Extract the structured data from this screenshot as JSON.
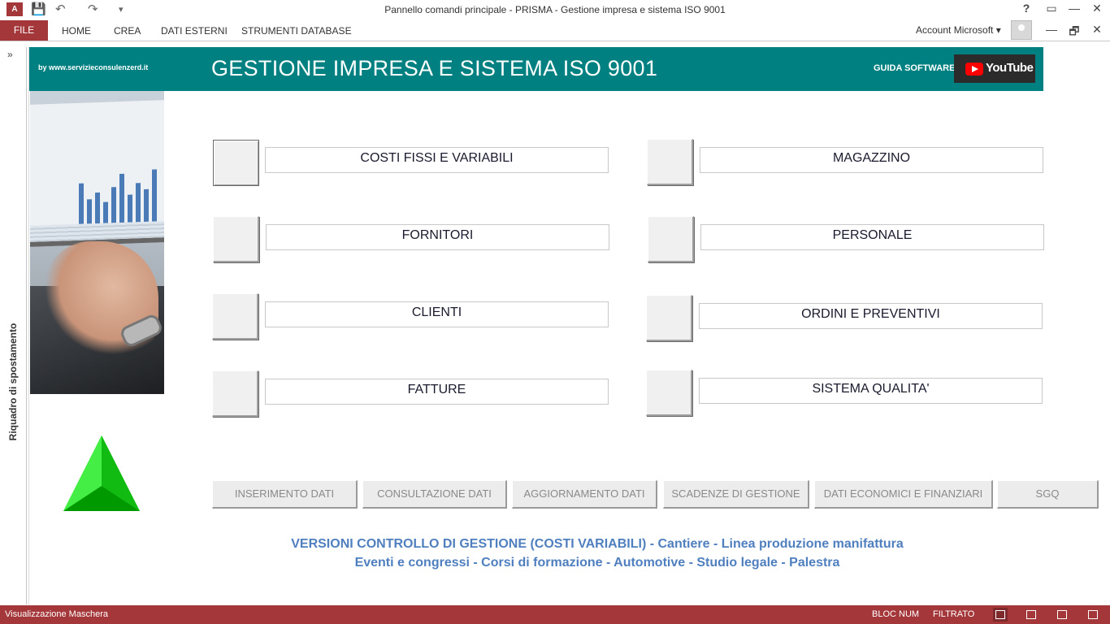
{
  "window": {
    "title": "Pannello comandi principale - PRISMA - Gestione impresa e sistema ISO 9001",
    "app_icon": "A",
    "help": "?",
    "restore": "🗗",
    "minimize": "—",
    "close": "✕"
  },
  "ribbon": {
    "file": "FILE",
    "tabs": [
      "HOME",
      "CREA",
      "DATI ESTERNI",
      "STRUMENTI DATABASE"
    ],
    "account": "Account Microsoft"
  },
  "navpane": {
    "expand": "»",
    "label": "Riquadro di spostamento"
  },
  "header": {
    "byline": "by www.servizieconsulenzerd.it",
    "title": "GESTIONE IMPRESA E SISTEMA ISO 9001",
    "guida": "GUIDA SOFTWARE",
    "youtube": "YouTube"
  },
  "main_buttons": {
    "costi": "COSTI FISSI E VARIABILI",
    "fornitori": "FORNITORI",
    "clienti": "CLIENTI",
    "fatture": "FATTURE",
    "magazzino": "MAGAZZINO",
    "personale": "PERSONALE",
    "ordini": "ORDINI E PREVENTIVI",
    "qualita": "SISTEMA QUALITA'"
  },
  "nav_buttons": {
    "inserimento": "INSERIMENTO DATI",
    "consultazione": "CONSULTAZIONE DATI",
    "aggiornamento": "AGGIORNAMENTO DATI",
    "scadenze": "SCADENZE DI GESTIONE",
    "economici": "DATI ECONOMICI E FINANZIARI",
    "sgq": "SGQ"
  },
  "versions": {
    "line1": "VERSIONI CONTROLLO DI GESTIONE (COSTI VARIABILI) - Cantiere - Linea produzione manifattura",
    "line2": "Eventi e congressi - Corsi di formazione - Automotive - Studio legale - Palestra"
  },
  "status": {
    "left": "Visualizzazione Maschera",
    "bloc_num": "BLOC NUM",
    "filtrato": "FILTRATO"
  },
  "colors": {
    "accent": "#a4373a",
    "header_band": "#008080",
    "versions_text": "#4f7fbf",
    "logo_green": "#22cc22"
  }
}
